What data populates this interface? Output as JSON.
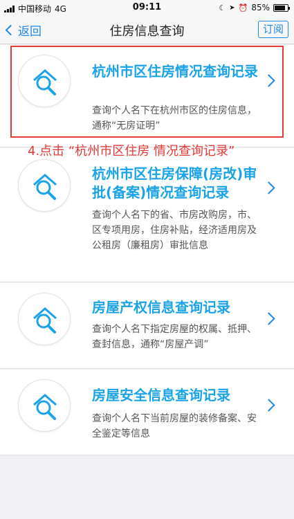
{
  "status_bar": {
    "carrier": "中国移动",
    "network": "4G",
    "time": "09:11",
    "battery": "85%",
    "battery_level": 0.85
  },
  "nav": {
    "back_label": "返回",
    "title": "住房信息查询",
    "subscribe_label": "订阅"
  },
  "annotation": "4.点击 “杭州市区住房 情况查询记录”",
  "cards": [
    {
      "title": "杭州市区住房情况查询记录",
      "desc": "查询个人名下在杭州市区的住房信息，通称“无房证明”",
      "icon": "house-search-icon"
    },
    {
      "title": "杭州市区住房保障(房改)审批(备案)情况查询记录",
      "desc": "查询个人名下的省、市房改购房，市、区专项用房，住房补贴，经济适用房及公租房（廉租房）审批信息",
      "icon": "house-search-icon"
    },
    {
      "title": "房屋产权信息查询记录",
      "desc": "查询个人名下指定房屋的权属、抵押、查封信息，通称“房屋产调”",
      "icon": "house-search-icon"
    },
    {
      "title": "房屋安全信息查询记录",
      "desc": "查询个人名下当前房屋的装修备案、安全鉴定等信息",
      "icon": "house-search-icon"
    }
  ],
  "colors": {
    "accent": "#1e88e5",
    "title": "#1aa3e8",
    "annotation": "#e53935"
  }
}
